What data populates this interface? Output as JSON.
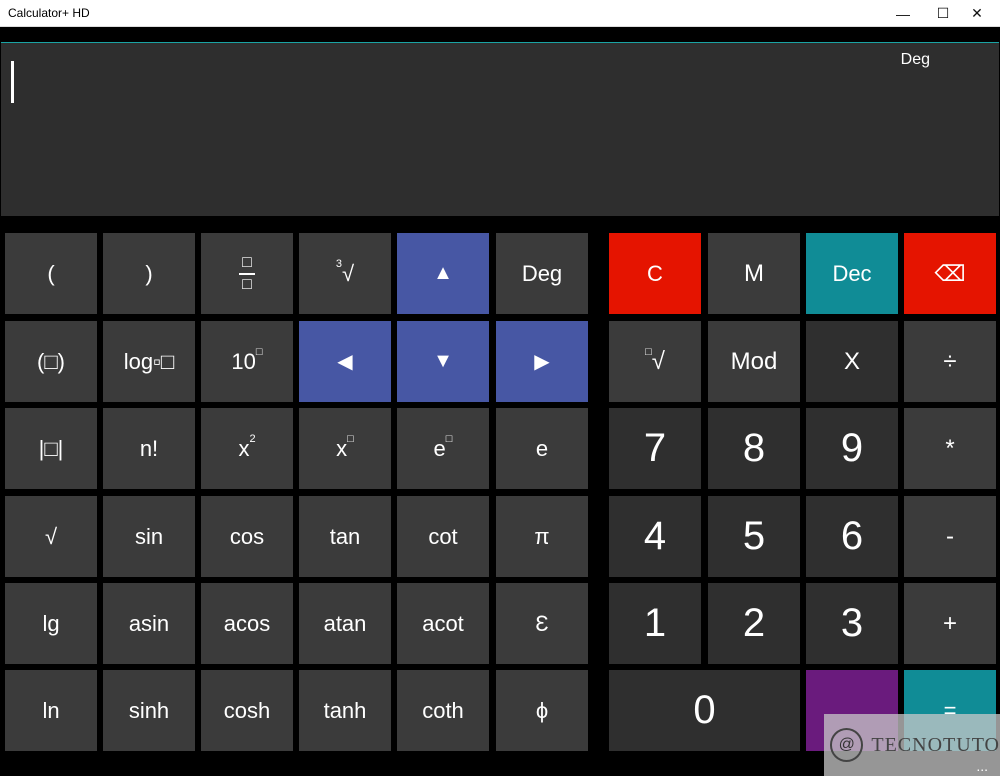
{
  "window": {
    "title": "Calculator+ HD",
    "minimize_glyph": "—",
    "maximize_glyph": "☐",
    "close_glyph": "✕"
  },
  "display": {
    "mode": "Deg"
  },
  "scientific_keys": {
    "open_paren": "(",
    "close_paren": ")",
    "fraction_glyph": "□",
    "cube_root_index": "3",
    "cube_root_sign": "√",
    "up_arrow": "▲",
    "deg": "Deg",
    "paren_box": "(□)",
    "log_base": "log▫□",
    "ten_power_base": "10",
    "ten_power_sup": "□",
    "left_arrow": "◀",
    "down_arrow": "▼",
    "right_arrow": "▶",
    "abs": "|□|",
    "factorial": "n!",
    "square_base": "x",
    "square_sup": "2",
    "power_base": "x",
    "power_sup": "□",
    "exp_base": "e",
    "exp_sup": "□",
    "e_const": "e",
    "sqrt": "√",
    "sin": "sin",
    "cos": "cos",
    "tan": "tan",
    "cot": "cot",
    "pi": "π",
    "lg": "lg",
    "asin": "asin",
    "acos": "acos",
    "atan": "atan",
    "acot": "acot",
    "epsilon": "Ɛ",
    "ln": "ln",
    "sinh": "sinh",
    "cosh": "cosh",
    "tanh": "tanh",
    "coth": "coth",
    "phi": "ϕ"
  },
  "standard_keys": {
    "clear": "C",
    "memory": "M",
    "dec": "Dec",
    "backspace": "⌫",
    "nth_root_index": "□",
    "nth_root_sign": "√",
    "mod": "Mod",
    "times_x": "X",
    "divide": "÷",
    "seven": "7",
    "eight": "8",
    "nine": "9",
    "multiply": "*",
    "four": "4",
    "five": "5",
    "six": "6",
    "minus": "-",
    "one": "1",
    "two": "2",
    "three": "3",
    "plus": "+",
    "zero": "0",
    "equals": "="
  },
  "watermark": {
    "text": "TECNOTUTO"
  },
  "more_menu": "...",
  "colors": {
    "function_key": "#3b3b3b",
    "number_key": "#2f2f2f",
    "nav_key": "#4757a4",
    "red_key": "#e51400",
    "teal_key": "#108c96",
    "purple_key": "#6a1b7d"
  }
}
